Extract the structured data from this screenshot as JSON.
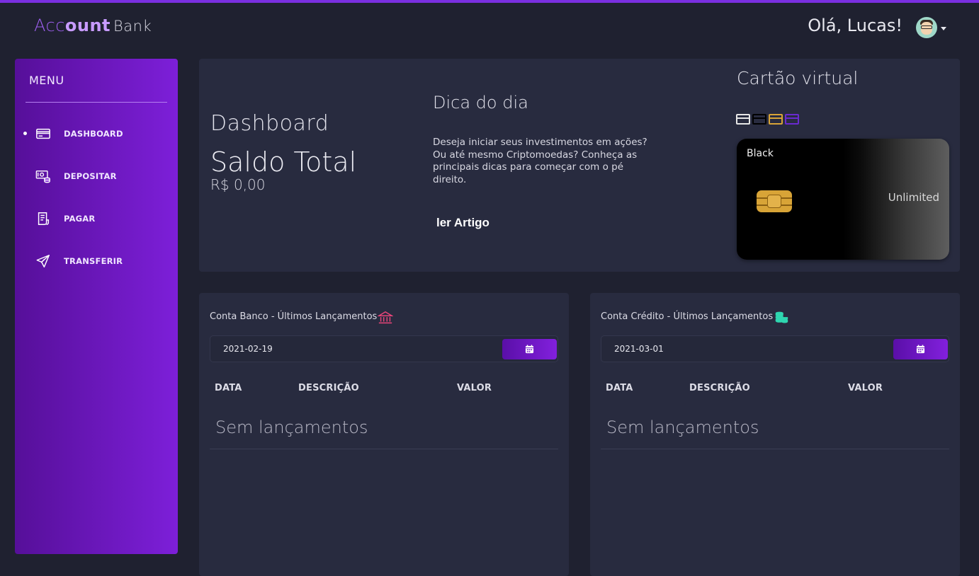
{
  "header": {
    "logo_acc": "Acc",
    "logo_ount": "ount",
    "logo_bank": "Bank",
    "greeting": "Olá, Lucas!",
    "avatar_icon": "user-avatar-icon"
  },
  "sidebar": {
    "title": "MENU",
    "active_index": 0,
    "items": [
      {
        "label": "DASHBOARD",
        "icon": "credit-card-icon"
      },
      {
        "label": "DEPOSITAR",
        "icon": "money-deposit-icon"
      },
      {
        "label": "PAGAR",
        "icon": "receipt-icon"
      },
      {
        "label": "TRANSFERIR",
        "icon": "paper-plane-icon"
      }
    ]
  },
  "dashboard": {
    "title": "Dashboard",
    "saldo_title": "Saldo Total",
    "saldo_value": "R$ 0,00"
  },
  "tip": {
    "title": "Dica do dia",
    "text": "Deseja iniciar seus investimentos em ações? Ou até mesmo Criptomoedas? Conheça as principais dicas para começar com o pé direito.",
    "button": "ler Artigo"
  },
  "virtual_card": {
    "title": "Cartão virtual",
    "swatch_colors": [
      "#e6e6e6",
      "#000000",
      "#d8a437",
      "#6a2ad0"
    ],
    "type": "Black",
    "level": "Unlimited"
  },
  "bank_account": {
    "title": "Conta Banco - Últimos Lançamentos",
    "icon": "bank-icon",
    "icon_color": "#e8457a",
    "date": "2021-02-19",
    "columns": [
      "DATA",
      "DESCRIÇÃO",
      "VALOR"
    ],
    "empty_text": "Sem lançamentos"
  },
  "credit_account": {
    "title": "Conta Crédito - Últimos Lançamentos",
    "icon": "coins-stack-icon",
    "icon_color": "#2fd6b0",
    "date": "2021-03-01",
    "columns": [
      "DATA",
      "DESCRIÇÃO",
      "VALOR"
    ],
    "empty_text": "Sem lançamentos"
  },
  "colors": {
    "background": "#1f2130",
    "panel": "#282b3f",
    "accent": "#7d1fd9"
  }
}
